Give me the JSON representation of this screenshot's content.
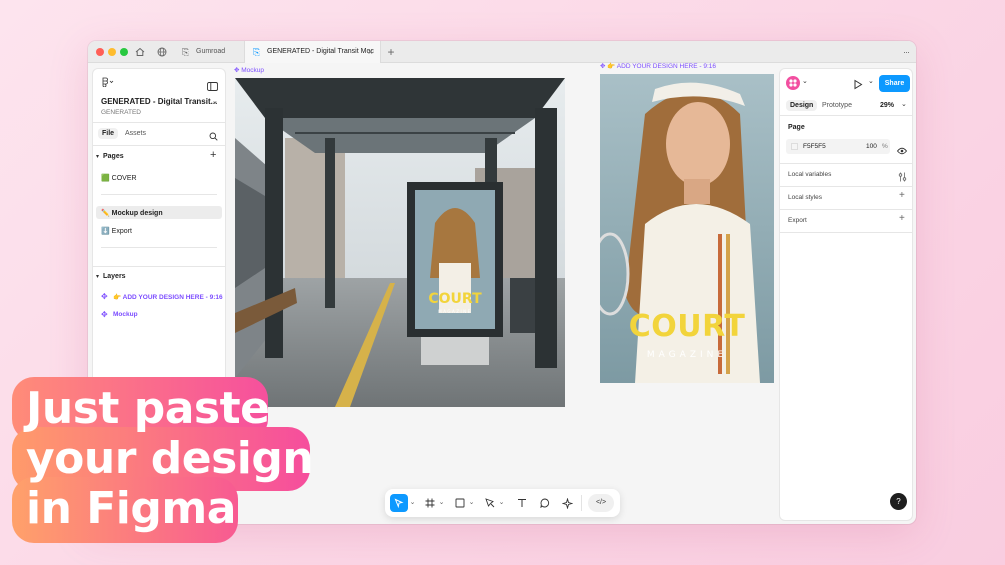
{
  "colors": {
    "accent_blue": "#0d99ff",
    "figma_purple": "#7c4dff",
    "headline_pink": "#f7459a",
    "headline_orange": "#ff9b6a"
  },
  "titlebar": {
    "home_icon": "home-icon",
    "globe_icon": "globe-icon",
    "tabs": [
      {
        "label": "Gumroad",
        "icon": "figma-file-icon"
      },
      {
        "label": "GENERATED - Digital Transit Moc",
        "icon": "figma-file-icon",
        "close": "×"
      }
    ],
    "new_tab": "+",
    "more": "···"
  },
  "left_panel": {
    "file_title": "GENERATED - Digital Transit...",
    "file_subtitle": "GENERATED",
    "tab_file": "File",
    "tab_assets": "Assets",
    "pages_heading": "Pages",
    "add_page": "+",
    "pages": [
      {
        "label": "🟩 COVER"
      },
      {
        "label": "✏️ Mockup design",
        "selected": true
      },
      {
        "label": "⬇️ Export"
      }
    ],
    "layers_heading": "Layers",
    "layers": [
      {
        "label": "👉 ADD YOUR DESIGN HERE - 9:16"
      },
      {
        "label": "Mockup"
      }
    ]
  },
  "canvas": {
    "frame1_label": "Mockup",
    "frame2_label": "👉 ADD YOUR DESIGN HERE - 9:16",
    "poster_title": "COURT",
    "poster_subtitle": "MAGAZINE"
  },
  "right_panel": {
    "share": "Share",
    "tab_design": "Design",
    "tab_prototype": "Prototype",
    "zoom": "29%",
    "page_heading": "Page",
    "page_color": "F5F5F5",
    "opacity": "100",
    "percent": "%",
    "local_variables": "Local variables",
    "local_styles": "Local styles",
    "export": "Export",
    "help": "?"
  },
  "toolbar": {
    "dev_mode": "</>"
  },
  "headline": {
    "line1": "Just paste",
    "line2": "your design",
    "line3": "in Figma"
  }
}
